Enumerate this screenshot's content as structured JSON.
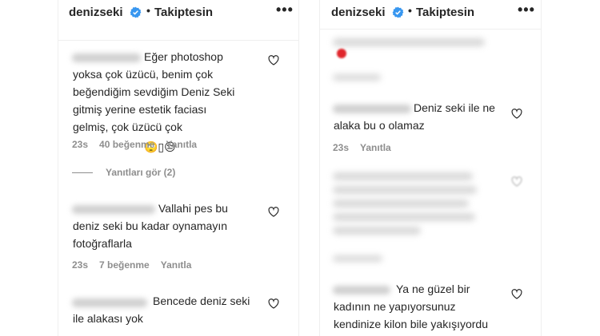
{
  "left_panel": {
    "header": {
      "username": "denizseki",
      "separator": "•",
      "follow_status": "Takiptesin",
      "more": "•••"
    },
    "comments": [
      {
        "text": "Eğer photoshop\nyoksa çok üzücü, benim çok\nbeğendiğim sevdiğim Deniz Seki\ngitmiş yerine estetik faciası\ngelmiş, çok üzücü çok",
        "emoji_text": "🙄▯😔",
        "time": "23s",
        "likes": "40 beğenme",
        "reply": "Yanıtla",
        "view_replies": "Yanıtları gör (2)"
      },
      {
        "text": "Vallahi pes bu\ndeniz seki bu kadar oynamayın\nfotoğraflarla",
        "time": "23s",
        "likes": "7 beğenme",
        "reply": "Yanıtla"
      },
      {
        "text": "Bencede deniz seki\nile alakası yok"
      }
    ]
  },
  "right_panel": {
    "header": {
      "username": "denizseki",
      "separator": "•",
      "follow_status": "Takiptesin",
      "more": "•••"
    },
    "comments": [
      {
        "text": "Deniz seki ile ne\nalaka bu o olamaz",
        "time": "23s",
        "reply": "Yanıtla"
      },
      {
        "text": "Ya ne güzel bir\nkadının ne yapıyorsunuz\nkendinize kilon bile yakışıyordu"
      }
    ]
  },
  "colors": {
    "text": "#262626",
    "muted": "#8e8e8e",
    "verified": "#3897f0",
    "divider": "#efefef"
  }
}
